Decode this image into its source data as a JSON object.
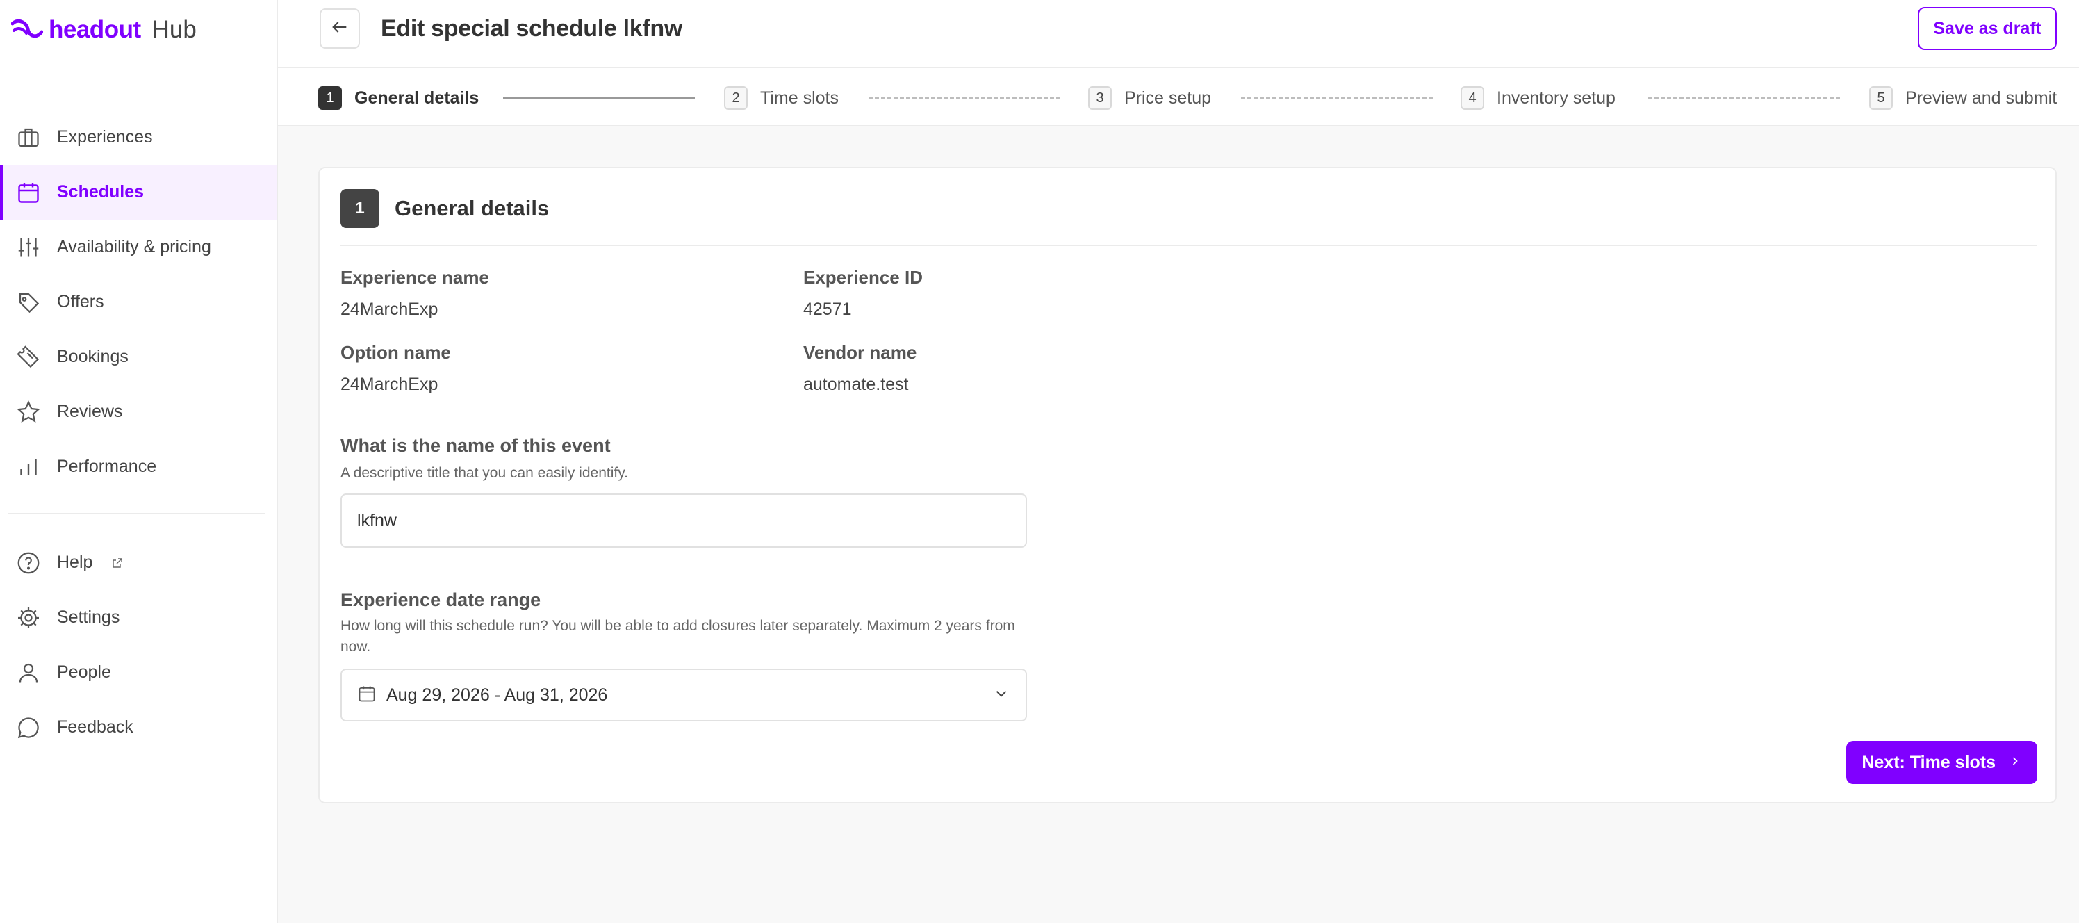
{
  "brand": {
    "name": "headout",
    "product": "Hub",
    "accent": "#8000ff"
  },
  "sidebar": {
    "items": [
      {
        "label": "Experiences",
        "icon": "briefcase-icon"
      },
      {
        "label": "Schedules",
        "icon": "calendar-icon",
        "active": true
      },
      {
        "label": "Availability & pricing",
        "icon": "sliders-icon"
      },
      {
        "label": "Offers",
        "icon": "tag-icon"
      },
      {
        "label": "Bookings",
        "icon": "ticket-icon"
      },
      {
        "label": "Reviews",
        "icon": "star-icon"
      },
      {
        "label": "Performance",
        "icon": "bar-chart-icon"
      }
    ],
    "secondary": [
      {
        "label": "Help",
        "icon": "help-circle-icon"
      },
      {
        "label": "Settings",
        "icon": "gear-icon"
      },
      {
        "label": "People",
        "icon": "user-icon"
      },
      {
        "label": "Feedback",
        "icon": "chat-bubble-icon"
      }
    ]
  },
  "header": {
    "title": "Edit special schedule lkfnw",
    "save_draft": "Save as draft"
  },
  "stepper": [
    {
      "num": "1",
      "label": "General details",
      "state": "current"
    },
    {
      "num": "2",
      "label": "Time slots",
      "state": "pending"
    },
    {
      "num": "3",
      "label": "Price setup",
      "state": "pending"
    },
    {
      "num": "4",
      "label": "Inventory setup",
      "state": "pending"
    },
    {
      "num": "5",
      "label": "Preview and submit",
      "state": "pending"
    }
  ],
  "card": {
    "num": "1",
    "title": "General details",
    "fields": {
      "experience_name_label": "Experience name",
      "experience_name": "24MarchExp",
      "experience_id_label": "Experience ID",
      "experience_id": "42571",
      "option_name_label": "Option name",
      "option_name": "24MarchExp",
      "vendor_name_label": "Vendor name",
      "vendor_name": "automate.test"
    },
    "event_name": {
      "label": "What is the name of this event",
      "description": "A descriptive title that you can easily identify.",
      "value": "lkfnw"
    },
    "date_range": {
      "label": "Experience date range",
      "description": "How long will this schedule run? You will be able to add closures later separately. Maximum 2 years from now.",
      "value": "Aug 29, 2026 - Aug 31, 2026"
    },
    "next_button": "Next: Time slots"
  }
}
